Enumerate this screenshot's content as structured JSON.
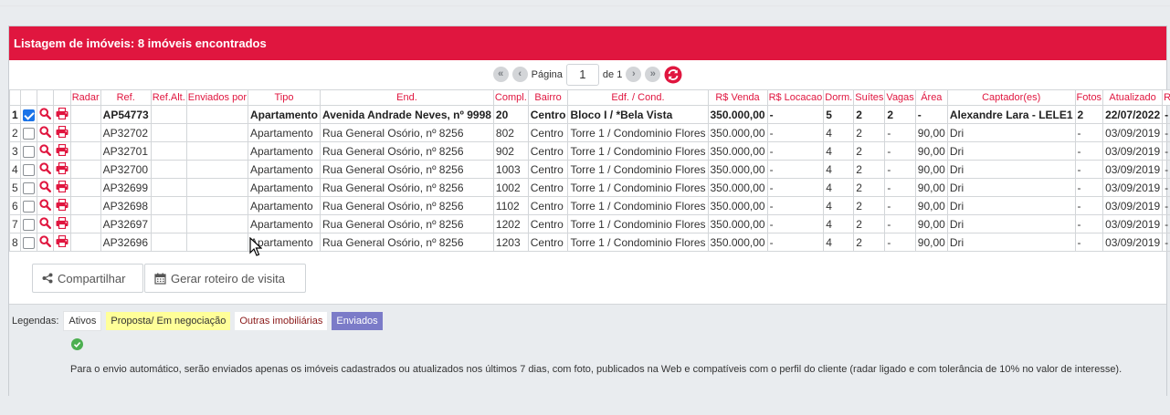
{
  "panel_title": "Listagem de imóveis: 8 imóveis encontrados",
  "pager": {
    "page_label": "Página",
    "page_value": "1",
    "of_label": "de 1"
  },
  "columns": [
    "",
    "",
    "",
    "Radar",
    "Ref.",
    "Ref.Alt.",
    "Enviados por",
    "Tipo",
    "End.",
    "Compl.",
    "Bairro",
    "Edf. / Cond.",
    "R$ Venda",
    "R$ Locacao",
    "Dorm.",
    "Suítes",
    "Vagas",
    "Área",
    "Captador(es)",
    "Fotos",
    "Atualizado",
    "R$ Cond."
  ],
  "rows": [
    {
      "n": "1",
      "checked": true,
      "radar": "",
      "ref": "AP54773",
      "ref_alt": "",
      "enviados": "",
      "tipo": "Apartamento",
      "end": "Avenida Andrade Neves, nº 9998",
      "compl": "20",
      "bairro": "Centro",
      "edf": "Bloco I / *Bela Vista",
      "venda": "350.000,00",
      "locacao": "-",
      "dorm": "5",
      "suites": "2",
      "vagas": "2",
      "area": "-",
      "captador": "Alexandre Lara - LELE1",
      "fotos": "2",
      "atualizado": "22/07/2022",
      "cond": "-"
    },
    {
      "n": "2",
      "checked": false,
      "radar": "",
      "ref": "AP32702",
      "ref_alt": "",
      "enviados": "",
      "tipo": "Apartamento",
      "end": "Rua General Osório, nº 8256",
      "compl": "802",
      "bairro": "Centro",
      "edf": "Torre 1 / Condominio Flores",
      "venda": "350.000,00",
      "locacao": "-",
      "dorm": "4",
      "suites": "2",
      "vagas": "-",
      "area": "90,00",
      "captador": "Dri",
      "fotos": "-",
      "atualizado": "03/09/2019",
      "cond": "-"
    },
    {
      "n": "3",
      "checked": false,
      "radar": "",
      "ref": "AP32701",
      "ref_alt": "",
      "enviados": "",
      "tipo": "Apartamento",
      "end": "Rua General Osório, nº 8256",
      "compl": "902",
      "bairro": "Centro",
      "edf": "Torre 1 / Condominio Flores",
      "venda": "350.000,00",
      "locacao": "-",
      "dorm": "4",
      "suites": "2",
      "vagas": "-",
      "area": "90,00",
      "captador": "Dri",
      "fotos": "-",
      "atualizado": "03/09/2019",
      "cond": "-"
    },
    {
      "n": "4",
      "checked": false,
      "radar": "",
      "ref": "AP32700",
      "ref_alt": "",
      "enviados": "",
      "tipo": "Apartamento",
      "end": "Rua General Osório, nº 8256",
      "compl": "1003",
      "bairro": "Centro",
      "edf": "Torre 1 / Condominio Flores",
      "venda": "350.000,00",
      "locacao": "-",
      "dorm": "4",
      "suites": "2",
      "vagas": "-",
      "area": "90,00",
      "captador": "Dri",
      "fotos": "-",
      "atualizado": "03/09/2019",
      "cond": "-"
    },
    {
      "n": "5",
      "checked": false,
      "radar": "",
      "ref": "AP32699",
      "ref_alt": "",
      "enviados": "",
      "tipo": "Apartamento",
      "end": "Rua General Osório, nº 8256",
      "compl": "1002",
      "bairro": "Centro",
      "edf": "Torre 1 / Condominio Flores",
      "venda": "350.000,00",
      "locacao": "-",
      "dorm": "4",
      "suites": "2",
      "vagas": "-",
      "area": "90,00",
      "captador": "Dri",
      "fotos": "-",
      "atualizado": "03/09/2019",
      "cond": "-"
    },
    {
      "n": "6",
      "checked": false,
      "radar": "",
      "ref": "AP32698",
      "ref_alt": "",
      "enviados": "",
      "tipo": "Apartamento",
      "end": "Rua General Osório, nº 8256",
      "compl": "1102",
      "bairro": "Centro",
      "edf": "Torre 1 / Condominio Flores",
      "venda": "350.000,00",
      "locacao": "-",
      "dorm": "4",
      "suites": "2",
      "vagas": "-",
      "area": "90,00",
      "captador": "Dri",
      "fotos": "-",
      "atualizado": "03/09/2019",
      "cond": "-"
    },
    {
      "n": "7",
      "checked": false,
      "radar": "",
      "ref": "AP32697",
      "ref_alt": "",
      "enviados": "",
      "tipo": "Apartamento",
      "end": "Rua General Osório, nº 8256",
      "compl": "1202",
      "bairro": "Centro",
      "edf": "Torre 1 / Condominio Flores",
      "venda": "350.000,00",
      "locacao": "-",
      "dorm": "4",
      "suites": "2",
      "vagas": "-",
      "area": "90,00",
      "captador": "Dri",
      "fotos": "-",
      "atualizado": "03/09/2019",
      "cond": "-"
    },
    {
      "n": "8",
      "checked": false,
      "radar": "",
      "ref": "AP32696",
      "ref_alt": "",
      "enviados": "",
      "tipo": "Apartamento",
      "end": "Rua General Osório, nº 8256",
      "compl": "1203",
      "bairro": "Centro",
      "edf": "Torre 1 / Condominio Flores",
      "venda": "350.000,00",
      "locacao": "-",
      "dorm": "4",
      "suites": "2",
      "vagas": "-",
      "area": "90,00",
      "captador": "Dri",
      "fotos": "-",
      "atualizado": "03/09/2019",
      "cond": "-"
    }
  ],
  "buttons": {
    "share": "Compartilhar",
    "route": "Gerar roteiro de visita"
  },
  "legend": {
    "label": "Legendas:",
    "ativos": "Ativos",
    "proposta": "Proposta/ Em negociação",
    "outras": "Outras imobiliárias",
    "enviados": "Enviados"
  },
  "note": "Para o envio automático, serão enviados apenas os imóveis cadastrados ou atualizados nos últimos 7 dias, com foto, publicados na Web e compatíveis com o perfil do cliente (radar ligado e com tolerância de 10% no valor de interesse).",
  "colors": {
    "accent": "#e0163f",
    "legend_proposta": "#ffff99",
    "legend_enviados": "#7b7bc8",
    "checkbox": "#1a73e8",
    "ok_icon": "#4caf50"
  },
  "icons": [
    "first-page-icon",
    "prev-page-icon",
    "next-page-icon",
    "last-page-icon",
    "refresh-icon",
    "search-icon",
    "print-icon",
    "share-icon",
    "calendar-icon",
    "check-circle-icon",
    "mouse-cursor-icon"
  ]
}
